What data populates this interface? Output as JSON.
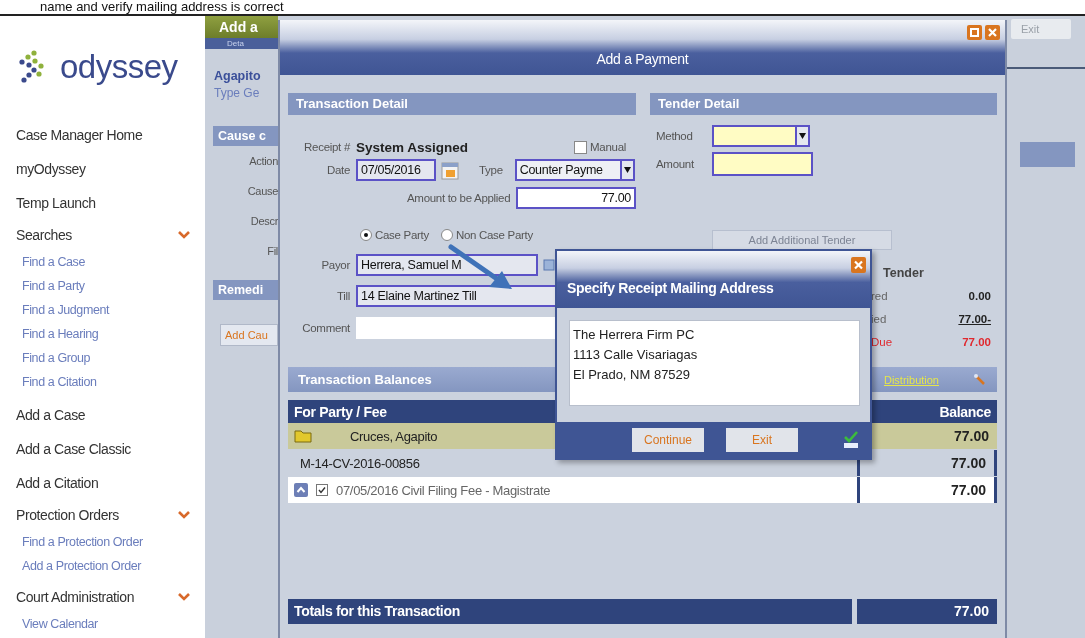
{
  "caption": "name and verify mailing address is correct",
  "sidebar": {
    "logo": "odyssey",
    "items": [
      {
        "kind": "link",
        "label": "Case Manager Home"
      },
      {
        "kind": "link",
        "label": "myOdyssey"
      },
      {
        "kind": "link",
        "label": "Temp Launch"
      },
      {
        "kind": "section",
        "label": "Searches",
        "expanded": true,
        "children": [
          {
            "label": "Find a Case"
          },
          {
            "label": "Find a Party"
          },
          {
            "label": "Find a Judgment"
          },
          {
            "label": "Find a Hearing"
          },
          {
            "label": "Find a Group"
          },
          {
            "label": "Find a Citation"
          }
        ]
      },
      {
        "kind": "link",
        "label": "Add a Case"
      },
      {
        "kind": "link",
        "label": "Add a Case Classic"
      },
      {
        "kind": "link",
        "label": "Add a Citation"
      },
      {
        "kind": "section",
        "label": "Protection Orders",
        "expanded": true,
        "children": [
          {
            "label": "Find a Protection Order"
          },
          {
            "label": "Add a Protection Order"
          }
        ]
      },
      {
        "kind": "section",
        "label": "Court Administration",
        "expanded": true,
        "children": [
          {
            "label": "View Calendar"
          }
        ]
      }
    ]
  },
  "background_page": {
    "header": "Add a",
    "tab": "Deta",
    "party": "Agapito",
    "type_label": "Type Ge",
    "section_1": "Cause c",
    "fields": [
      "Action",
      "Cause",
      "Descr",
      "Fil"
    ],
    "section_2": "Remedi",
    "add_button": "Add Cau",
    "exit_button": "Exit"
  },
  "payment_dialog": {
    "title": "Add a Payment",
    "transaction_detail": {
      "title": "Transaction Detail",
      "receipt_label": "Receipt #",
      "receipt_value": "System Assigned",
      "manual": {
        "label": "Manual",
        "checked": false
      },
      "date": {
        "label": "Date",
        "value": "07/05/2016"
      },
      "type": {
        "label": "Type",
        "value": "Counter Payme"
      },
      "amount": {
        "label": "Amount to be Applied",
        "value": "77.00"
      },
      "payor_options": [
        {
          "label": "Case Party",
          "selected": true
        },
        {
          "label": "Non Case Party",
          "selected": false
        }
      ],
      "payor": {
        "label": "Payor",
        "value": "Herrera, Samuel M"
      },
      "till": {
        "label": "Till",
        "value": "14 Elaine Martinez Till"
      },
      "comment": {
        "label": "Comment"
      }
    },
    "tender_detail": {
      "title": "Tender Detail",
      "method": {
        "label": "Method"
      },
      "amount": {
        "label": "Amount"
      },
      "add_button": {
        "label": "Add Additional Tender",
        "disabled": true
      },
      "summary_title": "Tender",
      "summary": [
        {
          "kind": "plain",
          "label": "red",
          "value": "0.00"
        },
        {
          "kind": "applied",
          "label": "ied",
          "value": "77.00-"
        },
        {
          "kind": "due",
          "label": "Due",
          "value": "77.00"
        }
      ]
    },
    "balances": {
      "title": "Transaction Balances",
      "distribution_link": "Distribution",
      "columns": [
        "For Party / Fee",
        "Balance"
      ],
      "rows": [
        {
          "kind": "party",
          "label": "Cruces, Agapito",
          "balance": "77.00"
        },
        {
          "kind": "case",
          "label": "M-14-CV-2016-00856",
          "balance": "77.00"
        },
        {
          "kind": "fee",
          "label": "07/05/2016 Civil Filing Fee - Magistrate",
          "balance": "77.00",
          "checked": true
        }
      ],
      "totals": {
        "label": "Totals for this Transaction",
        "value": "77.00"
      }
    }
  },
  "address_dialog": {
    "title": "Specify Receipt Mailing Address",
    "address_lines": [
      "The Herrera Firm PC",
      "1113 Calle Visariagas",
      "El Prado, NM 87529"
    ],
    "buttons": [
      "Continue",
      "Exit"
    ]
  }
}
